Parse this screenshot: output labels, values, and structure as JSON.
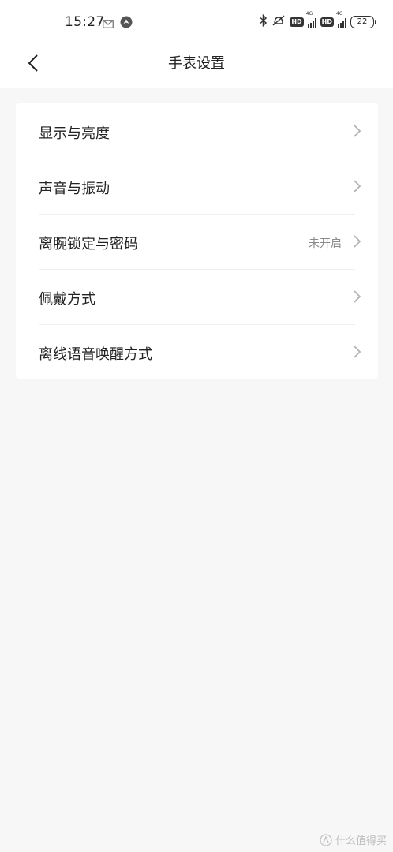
{
  "status_bar": {
    "time": "15:27",
    "left_icons": [
      "mail-icon",
      "app-notification-icon"
    ],
    "right_icons": [
      "bluetooth-icon",
      "vibrate-off-icon",
      "hd-badge",
      "signal-4g-icon",
      "hd-badge",
      "signal-4g-icon"
    ],
    "hd_label": "HD",
    "network_label": "4G",
    "battery": "22"
  },
  "header": {
    "back_icon": "chevron-left-icon",
    "title": "手表设置"
  },
  "settings": {
    "items": [
      {
        "label": "显示与亮度",
        "value": ""
      },
      {
        "label": "声音与振动",
        "value": ""
      },
      {
        "label": "离腕锁定与密码",
        "value": "未开启"
      },
      {
        "label": "佩戴方式",
        "value": ""
      },
      {
        "label": "离线语音唤醒方式",
        "value": ""
      }
    ],
    "chevron_icon": "chevron-right-icon"
  },
  "watermark": {
    "text": "什么值得买"
  }
}
